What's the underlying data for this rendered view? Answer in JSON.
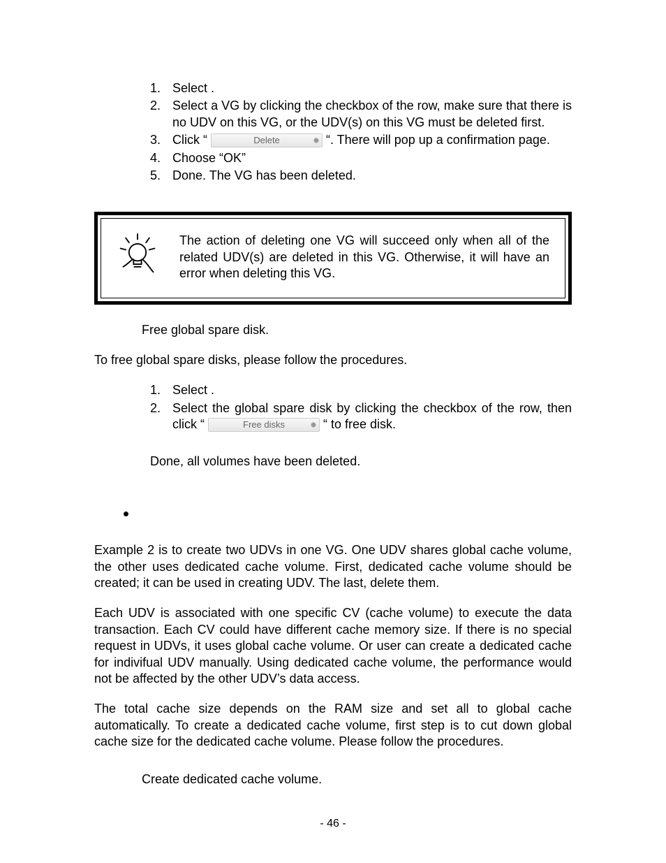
{
  "section1": {
    "items": [
      {
        "n": "1.",
        "text": "Select                                                              ."
      },
      {
        "n": "2.",
        "text": "Select a VG by clicking the checkbox of the row, make sure that there is no UDV on this VG, or the UDV(s) on this VG must be deleted first."
      },
      {
        "n": "3.",
        "pre": "Click “ ",
        "btn": "Delete",
        "post": " “. There will pop up a confirmation page."
      },
      {
        "n": "4.",
        "text": "Choose “OK”"
      },
      {
        "n": "5.",
        "text": "Done. The VG has been deleted."
      }
    ]
  },
  "note": "The action of deleting one VG will succeed only when all of the related UDV(s) are deleted in this VG. Otherwise, it will have an error when deleting this VG.",
  "step6_header": "Free global spare disk.",
  "para_free": "To free global spare disks, please follow the procedures.",
  "section2": {
    "items": [
      {
        "n": "1.",
        "text": "Select                                                              ."
      },
      {
        "n": "2.",
        "pre": "Select the global spare disk by clicking the checkbox of the row, then click “ ",
        "btn": "Free disks",
        "post": " “ to free disk."
      }
    ]
  },
  "done_line": "Done, all volumes have been deleted.",
  "para_ex2": "Example 2 is to create two UDVs in one VG. One UDV shares global cache volume, the other uses dedicated cache volume. First, dedicated cache volume should be created; it can be used in creating UDV. The last, delete them.",
  "para_cv": "Each UDV is associated with one specific CV (cache volume) to execute the data transaction. Each CV could have different cache memory size. If there is no special request in UDVs, it uses global cache volume. Or user can create a dedicated cache for indivifual UDV manually. Using dedicated cache volume, the performance would not be affected by the other UDV’s data access.",
  "para_total": "The total cache size depends on the RAM size and set all to global cache automatically. To create a dedicated cache volume, first step is to cut down global cache size for the dedicated cache volume. Please follow the procedures.",
  "step_create": "Create dedicated cache volume.",
  "page_num": "- 46 -"
}
